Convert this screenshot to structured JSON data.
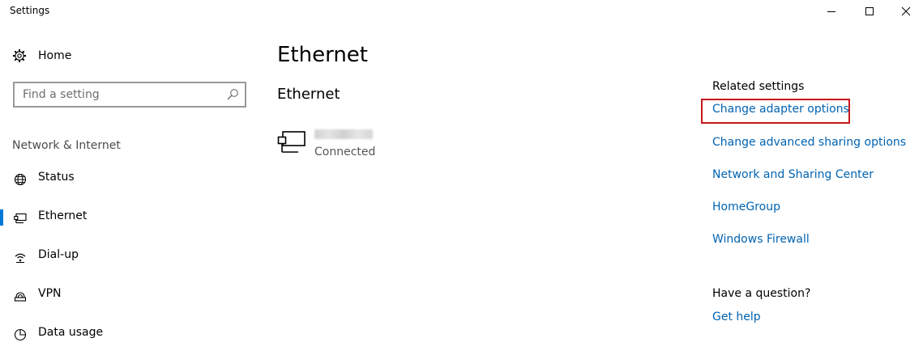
{
  "window": {
    "title": "Settings"
  },
  "sidebar": {
    "home_label": "Home",
    "search_placeholder": "Find a setting",
    "section_label": "Network & Internet",
    "items": [
      {
        "label": "Status",
        "icon": "globe-icon",
        "selected": false
      },
      {
        "label": "Ethernet",
        "icon": "ethernet-icon",
        "selected": true
      },
      {
        "label": "Dial-up",
        "icon": "dialup-icon",
        "selected": false
      },
      {
        "label": "VPN",
        "icon": "vpn-icon",
        "selected": false
      },
      {
        "label": "Data usage",
        "icon": "data-usage-icon",
        "selected": false
      }
    ]
  },
  "main": {
    "page_title": "Ethernet",
    "sub_title": "Ethernet",
    "connection": {
      "status": "Connected"
    }
  },
  "related": {
    "heading": "Related settings",
    "links": [
      "Change adapter options",
      "Change advanced sharing options",
      "Network and Sharing Center",
      "HomeGroup",
      "Windows Firewall"
    ]
  },
  "question": {
    "heading": "Have a question?",
    "link": "Get help"
  },
  "colors": {
    "accent": "#0078d7",
    "link": "#0063b1",
    "highlight": "#c8181c"
  }
}
